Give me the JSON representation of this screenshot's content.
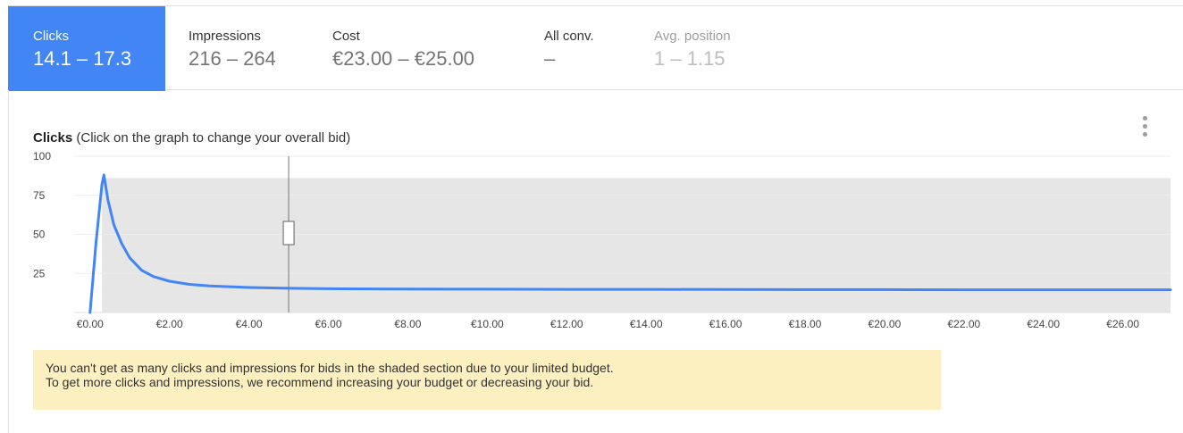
{
  "metrics": [
    {
      "label": "Clicks",
      "value": "14.1 – 17.3",
      "active": true,
      "enabled": true
    },
    {
      "label": "Impressions",
      "value": "216 – 264",
      "active": false,
      "enabled": true
    },
    {
      "label": "Cost",
      "value": "€23.00 – €25.00",
      "active": false,
      "enabled": true
    },
    {
      "label": "All conv.",
      "value": "–",
      "active": false,
      "enabled": true
    },
    {
      "label": "Avg. position",
      "value": "1 – 1.15",
      "active": false,
      "enabled": false
    }
  ],
  "chart_header": {
    "metric": "Clicks",
    "hint": "(Click on the graph to change your overall bid)"
  },
  "chart_data": {
    "type": "line",
    "series": [
      {
        "x": [
          0.0,
          0.15,
          0.3,
          0.35,
          0.45,
          0.6,
          0.8,
          1.0,
          1.3,
          1.6,
          2.0,
          2.5,
          3.0,
          4.0,
          5.0,
          6.0,
          8.0,
          10.0,
          12.0,
          14.0,
          16.0,
          18.0,
          20.0,
          22.0,
          24.0,
          26.0,
          27.2
        ],
        "y": [
          0,
          45,
          82,
          88,
          72,
          56,
          44,
          35,
          27,
          23,
          20,
          18,
          17,
          16,
          15.5,
          15.2,
          15.0,
          14.9,
          14.8,
          14.8,
          14.7,
          14.6,
          14.6,
          14.5,
          14.5,
          14.5,
          14.5
        ]
      }
    ],
    "x_ticks": [
      "€0.00",
      "€2.00",
      "€4.00",
      "€6.00",
      "€8.00",
      "€10.00",
      "€12.00",
      "€14.00",
      "€16.00",
      "€18.00",
      "€20.00",
      "€22.00",
      "€24.00",
      "€26.00"
    ],
    "x_tick_values": [
      0,
      2,
      4,
      6,
      8,
      10,
      12,
      14,
      16,
      18,
      20,
      22,
      24,
      26
    ],
    "y_ticks": [
      "100",
      "75",
      "50",
      "25"
    ],
    "y_tick_values": [
      100,
      75,
      50,
      25
    ],
    "xlim": [
      -0.4,
      27.2
    ],
    "ylim": [
      0,
      100
    ],
    "shaded_region": {
      "x_start": 0.3,
      "x_end": 27.2,
      "y_top": 86,
      "color": "#e6e6e6"
    },
    "current_bid": 5.0,
    "grid": true,
    "line_color": "#4285f4"
  },
  "notice": {
    "line1": "You can't get as many clicks and impressions for bids in the shaded section due to your limited budget.",
    "line2": "To get more clicks and impressions, we recommend increasing your budget or decreasing your bid."
  }
}
